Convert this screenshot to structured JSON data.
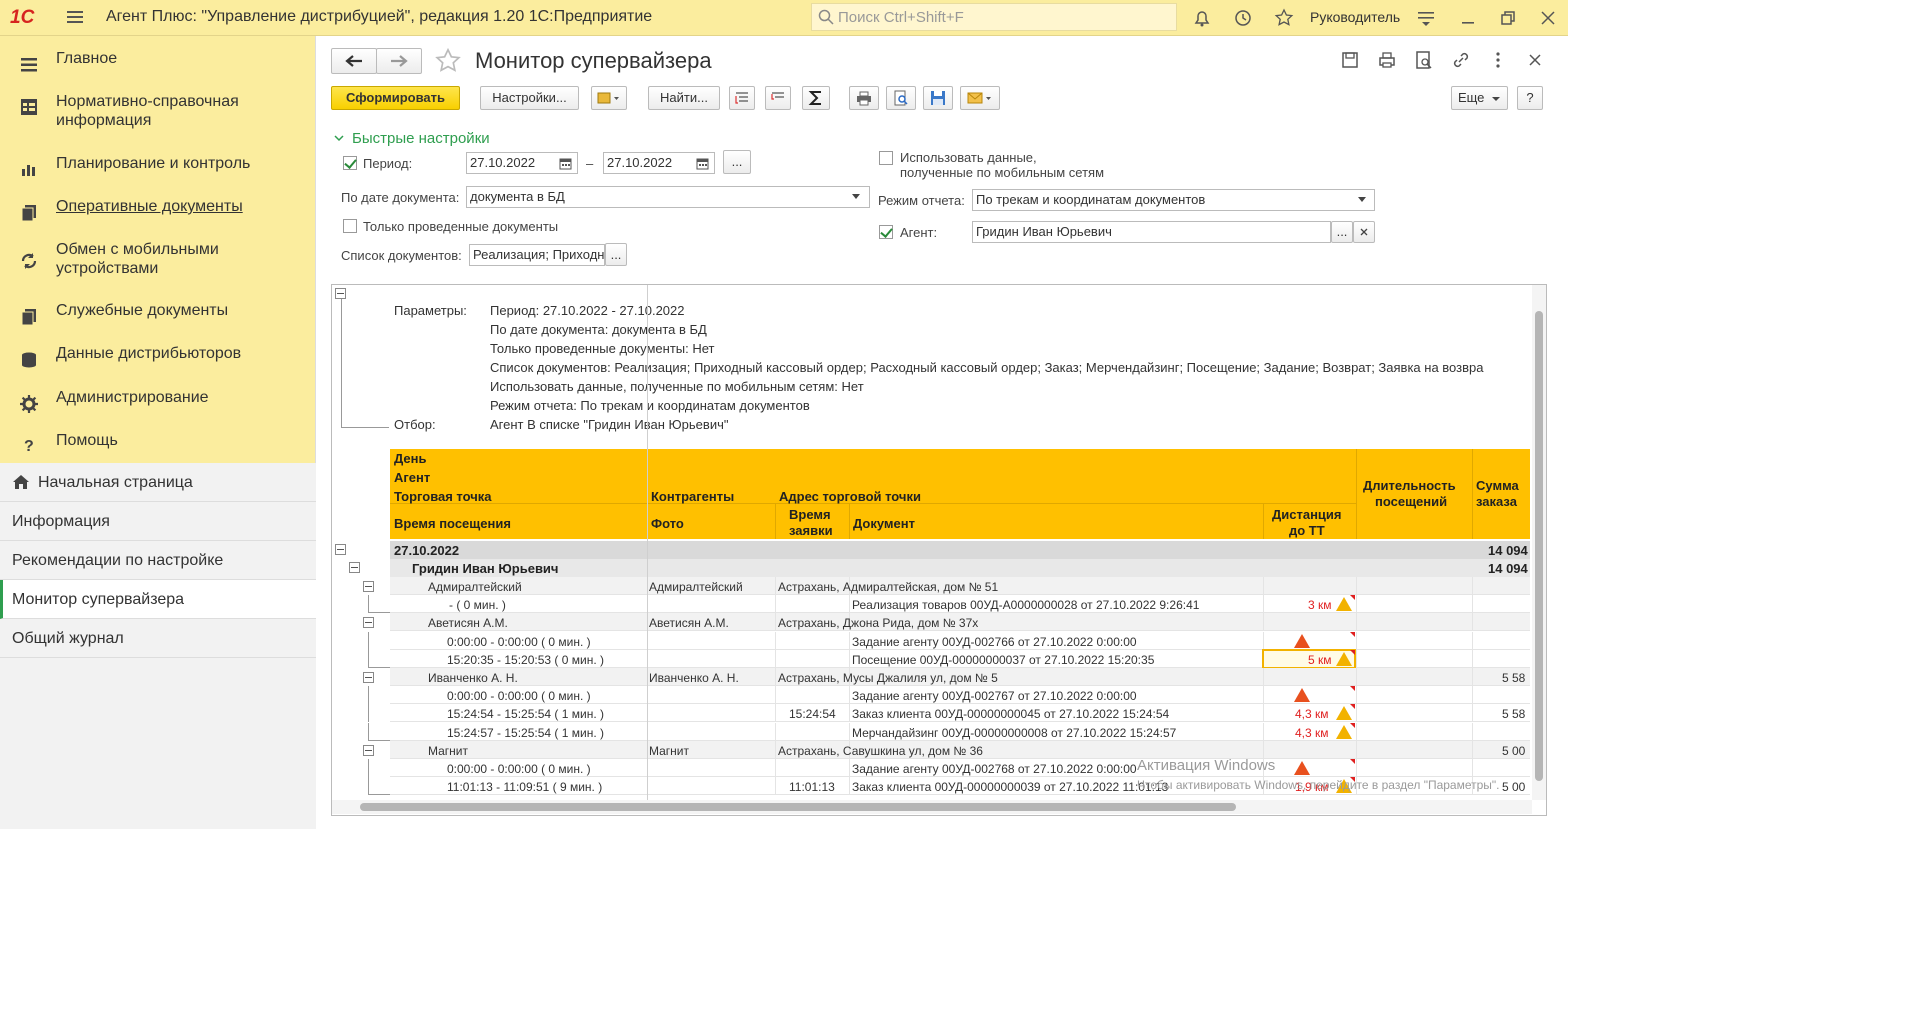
{
  "app": {
    "logo": "1С",
    "title": "Агент Плюс: \"Управление дистрибуцией\", редакция 1.20 1С:Предприятие",
    "search_placeholder": "Поиск Ctrl+Shift+F",
    "user": "Руководитель"
  },
  "sidebar": {
    "items": [
      {
        "label": "Главное",
        "icon": "hamburger-icon"
      },
      {
        "label": "Нормативно-справочная информация",
        "icon": "grid-icon"
      },
      {
        "label": "Планирование и контроль",
        "icon": "bar-chart-icon"
      },
      {
        "label": "Оперативные документы",
        "icon": "documents-icon"
      },
      {
        "label": "Обмен с мобильными устройствами",
        "icon": "sync-icon"
      },
      {
        "label": "Служебные документы",
        "icon": "documents-icon"
      },
      {
        "label": "Данные дистрибьюторов",
        "icon": "database-icon"
      },
      {
        "label": "Администрирование",
        "icon": "gear-icon"
      },
      {
        "label": "Помощь",
        "icon": "question-icon"
      }
    ]
  },
  "nav": {
    "items": [
      "Начальная страница",
      "Информация",
      "Рекомендации по настройке",
      "Монитор супервайзера",
      "Общий журнал"
    ]
  },
  "form": {
    "title": "Монитор супервайзера",
    "toolbar": {
      "generate": "Сформировать",
      "settings": "Настройки...",
      "find": "Найти...",
      "more": "Еще",
      "help": "?"
    },
    "quick_settings": "Быстрые настройки",
    "period_label": "Период:",
    "date_from": "27.10.2022",
    "date_sep": "–",
    "date_to": "27.10.2022",
    "dots": "...",
    "by_date_label": "По дате документа:",
    "by_date_value": "документа в БД",
    "only_posted_label": "Только проведенные документы",
    "doc_list_label": "Список документов:",
    "doc_list_value": "Реализация; Приходнь",
    "use_mobile_label_1": "Использовать данные,",
    "use_mobile_label_2": "полученные по мобильным сетям",
    "mode_label": "Режим отчета:",
    "mode_value": "По трекам и координатам документов",
    "agent_label": "Агент:",
    "agent_value": "Гридин Иван Юрьевич"
  },
  "report": {
    "params_label": "Параметры:",
    "params": [
      "Период: 27.10.2022 - 27.10.2022",
      "По дате документа: документа в БД",
      "Только проведенные документы: Нет",
      "Список документов: Реализация; Приходный кассовый ордер; Расходный кассовый ордер; Заказ; Мерчендайзинг; Посещение; Задание; Возврат; Заявка на возвра",
      "Использовать данные, полученные по мобильным сетям: Нет",
      "Режим отчета: По трекам и координатам документов"
    ],
    "filter_label": "Отбор:",
    "filter_value": "Агент В списке \"Гридин Иван Юрьевич\"",
    "headers": {
      "day": "День",
      "agent": "Агент",
      "point": "Торговая точка",
      "counterparties": "Контрагенты",
      "address": "Адрес торговой точки",
      "visit_time": "Время посещения",
      "photo": "Фото",
      "order_time_1": "Время",
      "order_time_2": "заявки",
      "document": "Документ",
      "distance_1": "Дистанция",
      "distance_2": "до ТТ",
      "duration_1": "Длительность",
      "duration_2": "посещений",
      "sum_1": "Сумма",
      "sum_2": "заказа"
    },
    "day_row": {
      "date": "27.10.2022",
      "sum": "14 094"
    },
    "agent_row": {
      "name": "Гридин Иван Юрьевич",
      "sum": "14 094"
    },
    "rows": [
      {
        "kind": "point",
        "c1": "Адмиралтейский",
        "c2": "Адмиралтейский",
        "c3": "Астрахань, Адмиралтейская, дом № 51",
        "sum": ""
      },
      {
        "kind": "visit",
        "c1": "-  ( 0 мин. )",
        "time": "",
        "doc": "Реализация товаров 00УД-A0000000028 от 27.10.2022 9:26:41",
        "dist": "3 км",
        "warn": "y",
        "sum": ""
      },
      {
        "kind": "point",
        "c1": "Аветисян А.М.",
        "c2": "Аветисян А.М.",
        "c3": "Астрахань, Джона Рида, дом № 37х",
        "sum": ""
      },
      {
        "kind": "visit",
        "c1": "0:00:00 - 0:00:00 ( 0 мин. )",
        "time": "",
        "doc": "Задание агенту 00УД-002766 от 27.10.2022 0:00:00",
        "dist": "",
        "warn": "r",
        "sum": ""
      },
      {
        "kind": "visit",
        "c1": "15:20:35 - 15:20:53 ( 0 мин. )",
        "time": "",
        "doc": "Посещение 00УД-00000000037 от 27.10.2022 15:20:35",
        "dist": "5 км",
        "warn": "y",
        "sum": "",
        "selected": true
      },
      {
        "kind": "point",
        "c1": "Иванченко А. Н.",
        "c2": "Иванченко А. Н.",
        "c3": "Астрахань, Мусы Джалиля ул, дом № 5",
        "sum": "5 58"
      },
      {
        "kind": "visit",
        "c1": "0:00:00 - 0:00:00 ( 0 мин. )",
        "time": "",
        "doc": "Задание агенту 00УД-002767 от 27.10.2022 0:00:00",
        "dist": "",
        "warn": "r",
        "sum": ""
      },
      {
        "kind": "visit",
        "c1": "15:24:54 - 15:25:54 ( 1 мин. )",
        "time": "15:24:54",
        "doc": "Заказ клиента 00УД-00000000045 от 27.10.2022 15:24:54",
        "dist": "4,3 км",
        "warn": "y",
        "sum": "5 58"
      },
      {
        "kind": "visit",
        "c1": "15:24:57 - 15:25:54 ( 1 мин. )",
        "time": "",
        "doc": "Мерчандайзинг 00УД-00000000008 от 27.10.2022 15:24:57",
        "dist": "4,3 км",
        "warn": "y",
        "sum": ""
      },
      {
        "kind": "point",
        "c1": "Магнит",
        "c2": "Магнит",
        "c3": "Астрахань, Савушкина ул, дом № 36",
        "sum": "5 00"
      },
      {
        "kind": "visit",
        "c1": "0:00:00 - 0:00:00 ( 0 мин. )",
        "time": "",
        "doc": "Задание агенту 00УД-002768 от 27.10.2022 0:00:00",
        "dist": "",
        "warn": "r",
        "sum": ""
      },
      {
        "kind": "visit",
        "c1": "11:01:13 - 11:09:51 ( 9 мин. )",
        "time": "11:01:13",
        "doc": "Заказ клиента 00УД-00000000039 от 27.10.2022 11:01:13",
        "dist": "1,9 км",
        "warn": "y",
        "sum": "5 00"
      }
    ],
    "watermark_1": "Активация Windows",
    "watermark_2": "Чтобы активировать Windows, перейдите в раздел \"Параметры\"."
  },
  "colors": {
    "header_bg": "#ffc000",
    "sidebar_bg": "#fbed9e",
    "accent": "#2f9e4f"
  }
}
